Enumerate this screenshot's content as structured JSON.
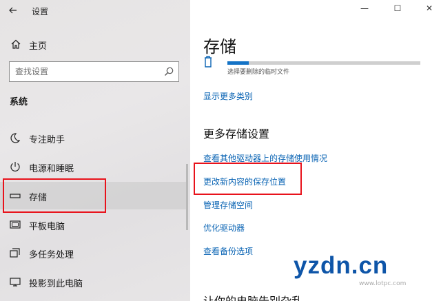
{
  "window": {
    "title": "设置",
    "controls": {
      "minimize": "—",
      "maximize": "☐",
      "close": "✕"
    }
  },
  "sidebar": {
    "home_label": "主页",
    "search_placeholder": "查找设置",
    "section_title": "系统",
    "items": [
      {
        "label": "专注助手",
        "icon": "moon-icon"
      },
      {
        "label": "电源和睡眠",
        "icon": "power-icon"
      },
      {
        "label": "存储",
        "icon": "storage-icon",
        "selected": true
      },
      {
        "label": "平板电脑",
        "icon": "tablet-icon"
      },
      {
        "label": "多任务处理",
        "icon": "multitask-icon"
      },
      {
        "label": "投影到此电脑",
        "icon": "project-icon"
      }
    ]
  },
  "main": {
    "title": "存储",
    "temp_files_caption": "选择要删除的临时文件",
    "temp_files_progress_fraction": 0.11,
    "show_more_link": "显示更多类别",
    "more_settings_heading": "更多存储设置",
    "links": [
      "查看其他驱动器上的存储使用情况",
      "更改新内容的保存位置",
      "管理存储空间",
      "优化驱动器",
      "查看备份选项"
    ],
    "bottom_heading": "让你的电脑告别杂乱"
  },
  "watermark": {
    "main": "yzdn.cn",
    "sub": "www.lotpc.com"
  },
  "colors": {
    "accent": "#0a64b4",
    "progress": "#1473c6",
    "highlight": "#e8121b"
  }
}
